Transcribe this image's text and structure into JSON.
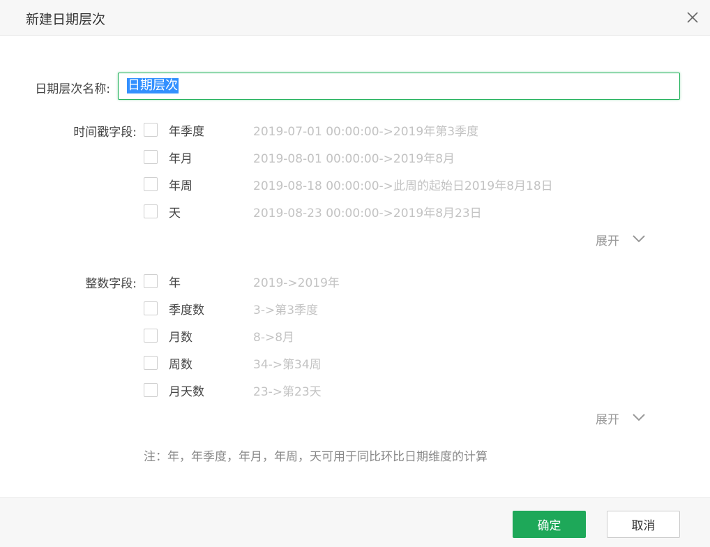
{
  "dialog": {
    "title": "新建日期层次",
    "close_icon": "close-icon"
  },
  "name_field": {
    "label": "日期层次名称:",
    "value": "日期层次"
  },
  "timestamp_section": {
    "label": "时间戳字段:",
    "options": [
      {
        "label": "年季度",
        "example": "2019-07-01 00:00:00->2019年第3季度",
        "checked": false
      },
      {
        "label": "年月",
        "example": "2019-08-01 00:00:00->2019年8月",
        "checked": false
      },
      {
        "label": "年周",
        "example": "2019-08-18 00:00:00->此周的起始日2019年8月18日",
        "checked": false
      },
      {
        "label": "天",
        "example": "2019-08-23 00:00:00->2019年8月23日",
        "checked": false
      }
    ],
    "expand_label": "展开",
    "expand_icon": "chevron-down-icon"
  },
  "integer_section": {
    "label": "整数字段:",
    "options": [
      {
        "label": "年",
        "example": "2019->2019年",
        "checked": false
      },
      {
        "label": "季度数",
        "example": "3->第3季度",
        "checked": false
      },
      {
        "label": "月数",
        "example": "8->8月",
        "checked": false
      },
      {
        "label": "周数",
        "example": "34->第34周",
        "checked": false
      },
      {
        "label": "月天数",
        "example": "23->第23天",
        "checked": false
      }
    ],
    "expand_label": "展开",
    "expand_icon": "chevron-down-icon"
  },
  "note": "注：年，年季度，年月，年周，天可用于同比环比日期维度的计算",
  "footer": {
    "ok_label": "确定",
    "cancel_label": "取消"
  },
  "colors": {
    "accent": "#1ea859",
    "selection": "#3390ff",
    "muted": "#c3c3c3"
  }
}
